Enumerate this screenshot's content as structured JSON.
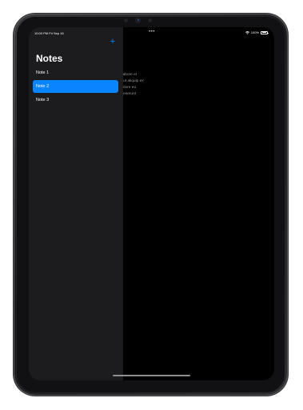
{
  "status_bar": {
    "time": "10:00 PM  Fri Sep 16",
    "multitask_dots": "•••",
    "battery": "100%"
  },
  "sidebar": {
    "title": "Notes",
    "add_icon": "plus-icon",
    "add_glyph": "+",
    "items": [
      {
        "label": "Note 1",
        "selected": false
      },
      {
        "label": "Note 2",
        "selected": true
      },
      {
        "label": "Note 3",
        "selected": false
      }
    ]
  },
  "detail": {
    "body_lines": [
      "Lorem ipsum dolor sit amet, consectetur adipiscing elit, sed do eiusmod tempor incididunt ut labore et",
      "dolore magna aliqua. Ut enim ad minim veniam, quis nostrud exercitation ullamco laboris nisi ut aliquip ex",
      "ea commodo consequat. Duis aute irure dolor in reprehenderit in voluptate velit esse cillum dolore eu",
      "fugiat nulla pariatur. Excepteur sint occaecat cupidatat non proident, sunt in culpa qui officia deserunt"
    ]
  },
  "colors": {
    "accent": "#0a84ff",
    "sidebar_bg": "#1c1c1e",
    "screen_bg": "#000000"
  }
}
